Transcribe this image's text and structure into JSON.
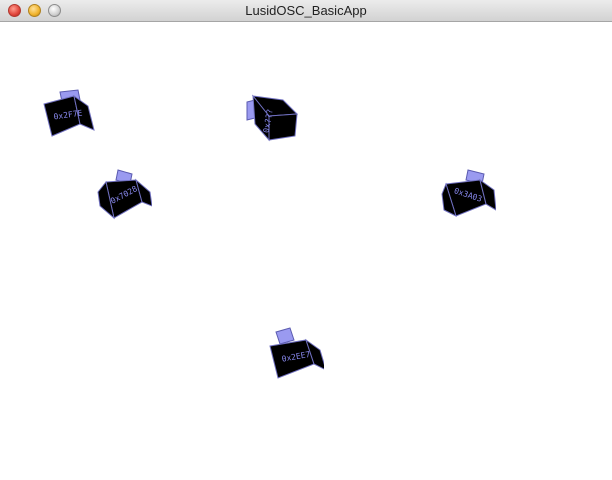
{
  "window": {
    "title": "LusidOSC_BasicApp"
  },
  "colors": {
    "cube_body": "#000000",
    "cube_edge": "#6f6fbf",
    "cube_tab": "#9a9af0",
    "cube_id_text": "#8a8af0"
  },
  "markers": [
    {
      "id_label": "0x2F7E",
      "icon": "cube-tab-top"
    },
    {
      "id_label": "0x???",
      "icon": "cube-tab-left"
    },
    {
      "id_label": "0x7028",
      "icon": "cube-tab-top"
    },
    {
      "id_label": "0x3A03",
      "icon": "cube-tab-top"
    },
    {
      "id_label": "0x2EE7",
      "icon": "cube-tab-top"
    }
  ]
}
